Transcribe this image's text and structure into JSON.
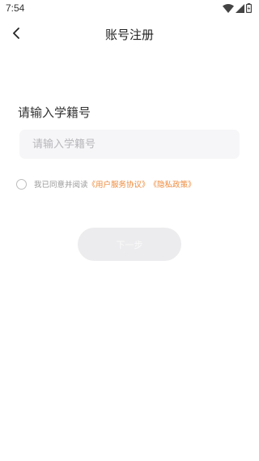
{
  "status_bar": {
    "time": "7:54",
    "icons": [
      "wifi-icon",
      "cellular-signal-icon",
      "battery-icon"
    ]
  },
  "nav": {
    "back_icon": "back-arrow-icon",
    "title": "账号注册"
  },
  "form": {
    "label": "请输入学籍号",
    "input_value": "",
    "input_placeholder": "请输入学籍号"
  },
  "agreement": {
    "checked": false,
    "prefix": "我已同意并阅读",
    "user_agreement_link": "《用户服务协议》",
    "privacy_link": "《隐私政策》",
    "link_color": "#ee8a3c"
  },
  "next_button": {
    "label": "下一步",
    "enabled": false
  }
}
